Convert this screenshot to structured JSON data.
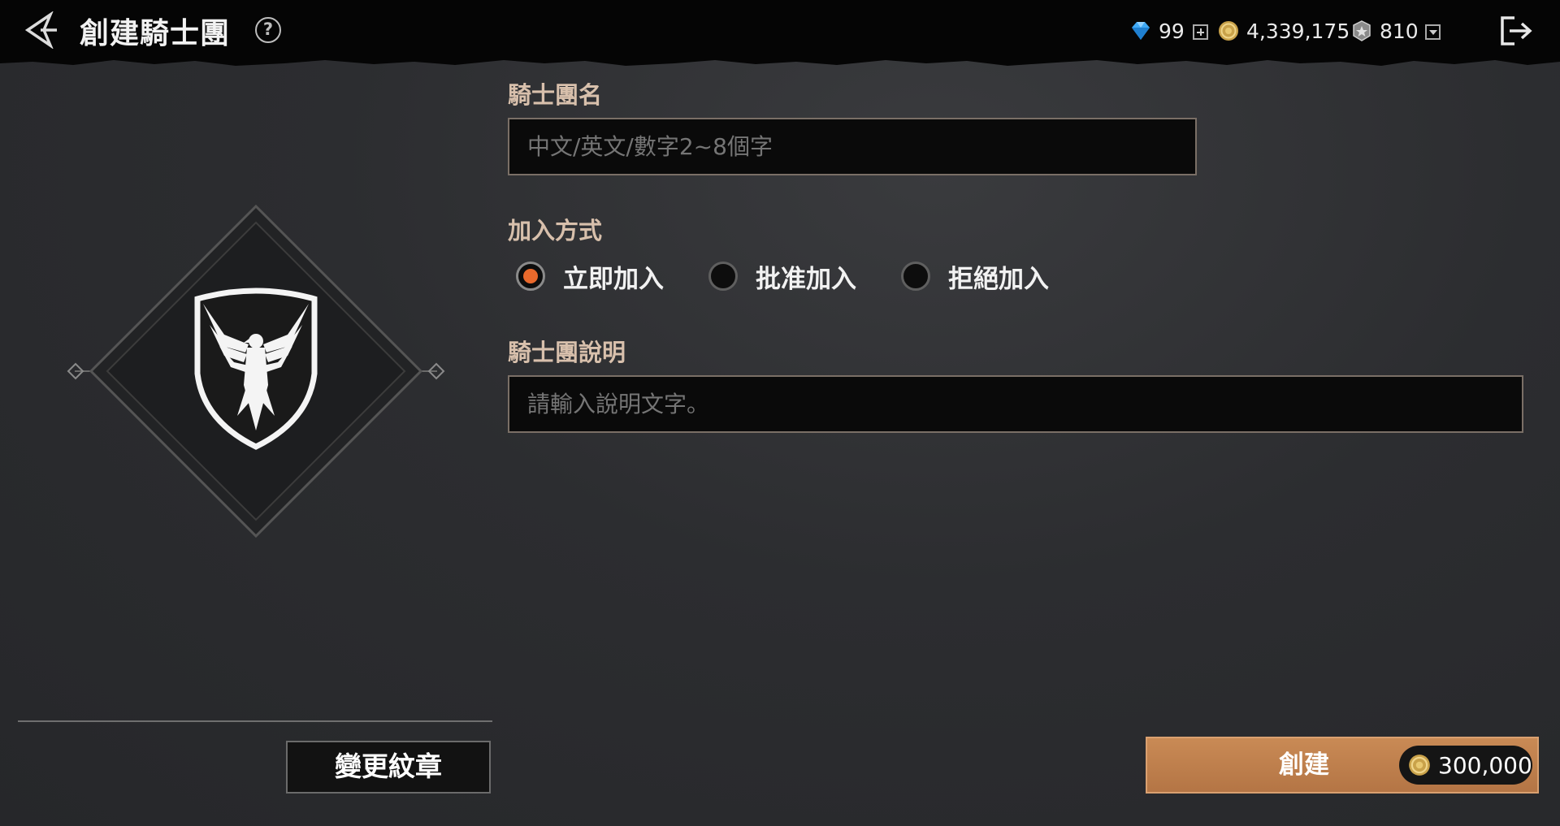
{
  "header": {
    "title": "創建騎士團",
    "help_symbol": "?",
    "currencies": [
      {
        "icon": "gem-icon",
        "value": "99"
      },
      {
        "icon": "gold-coin-icon",
        "value": "4,339,175"
      },
      {
        "icon": "silver-medal-icon",
        "value": "810"
      }
    ]
  },
  "emblem": {
    "icon": "eagle-shield-emblem",
    "change_button_label": "變更紋章"
  },
  "form": {
    "name_label": "騎士團名",
    "name_placeholder": "中文/英文/數字2~8個字",
    "join_label": "加入方式",
    "join_options": [
      {
        "label": "立即加入",
        "selected": true
      },
      {
        "label": "批准加入",
        "selected": false
      },
      {
        "label": "拒絕加入",
        "selected": false
      }
    ],
    "desc_label": "騎士團說明",
    "desc_placeholder": "請輸入說明文字。"
  },
  "create": {
    "label": "創建",
    "cost": "300,000",
    "cost_icon": "gold-coin-icon"
  },
  "colors": {
    "accent_orange": "#e9692c",
    "button_bronze": "#c48452",
    "label_tan": "#d8c0ac"
  }
}
